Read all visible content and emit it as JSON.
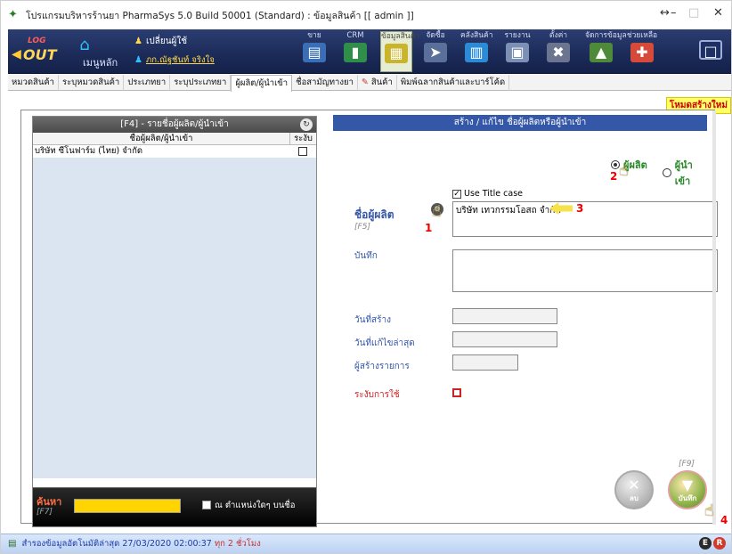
{
  "window": {
    "title": "โปรแกรมบริหารร้านยา PharmaSys 5.0 Build 50001 (Standard) : ข้อมูลสินค้า [[ admin ]]"
  },
  "toolbar": {
    "logout_log": "LOG",
    "logout_out": "OUT",
    "home_label": "เมนูหลัก",
    "change_user": "เปลี่ยนผู้ใช้",
    "user_name": "ภก.ณัฐชันท์ จริงใจ",
    "buttons": [
      {
        "label": "ขาย",
        "icon": "cart-icon"
      },
      {
        "label": "CRM",
        "icon": "crm-icon"
      },
      {
        "label": "ข้อมูลสินค้า",
        "icon": "product-data-icon"
      },
      {
        "label": "จัดซื้อ",
        "icon": "purchase-icon"
      },
      {
        "label": "คลังสินค้า",
        "icon": "warehouse-icon"
      },
      {
        "label": "รายงาน",
        "icon": "report-icon"
      },
      {
        "label": "ตั้งค่า",
        "icon": "settings-icon"
      },
      {
        "label": "จัดการข้อมูล",
        "icon": "data-management-icon"
      },
      {
        "label": "ช่วยเหลือ",
        "icon": "help-icon"
      }
    ]
  },
  "tabs": [
    {
      "label": "หมวดสินค้า"
    },
    {
      "label": "ระบุหมวดสินค้า"
    },
    {
      "label": "ประเภทยา"
    },
    {
      "label": "ระบุประเภทยา"
    },
    {
      "label": "ผู้ผลิต/ผู้นำเข้า"
    },
    {
      "label": "ชื่อสามัญทางยา"
    },
    {
      "label": "สินค้า"
    },
    {
      "label": "พิมพ์ฉลากสินค้าและบาร์โค้ด"
    }
  ],
  "mode_label": "โหมดสร้างใหม่",
  "list": {
    "header": "[F4] - รายชื่อผู้ผลิต/ผู้นำเข้า",
    "col_name": "ชื่อผู้ผลิต/ผู้นำเข้า",
    "col_suspend": "ระงับ",
    "rows": [
      {
        "name": "บริษัท ซีโนฟาร์ม (ไทย) จำกัด",
        "suspended": false
      }
    ],
    "search_label": "ค้นหา",
    "search_key": "[F7]",
    "search_value": "",
    "anywhere_label": "ณ ตำแหน่งใดๆ บนชื่อ"
  },
  "form": {
    "header": "สร้าง / แก้ไข ชื่อผู้ผลิตหรือผู้นำเข้า",
    "radio_manufacturer": "ผู้ผลิต",
    "radio_importer": "ผู้นำเข้า",
    "selected_type": "manufacturer",
    "use_title_case": "Use Title case",
    "use_title_case_checked": true,
    "name_label": "ชื่อผู้ผลิต",
    "name_key": "[F5]",
    "name_value": "บริษัท เทวกรรมโอสถ จำกัด",
    "note_label": "บันทึก",
    "note_value": "",
    "created_label": "วันที่สร้าง",
    "created_value": "",
    "modified_label": "วันที่แก้ไขล่าสุด",
    "modified_value": "",
    "creator_label": "ผู้สร้างรายการ",
    "creator_value": "",
    "suspend_label": "ระงับการใช้",
    "suspend_checked": false,
    "delete_label": "ลบ",
    "save_label": "บันทึก",
    "save_key": "[F9]"
  },
  "annotations": [
    "1",
    "2",
    "3",
    "4"
  ],
  "status": {
    "backup_text": "สำรองข้อมูลอัตโนมัติล่าสุด",
    "backup_time": "27/03/2020 02:00:37",
    "elapsed": "ทุก 2 ชั่วโมง"
  }
}
